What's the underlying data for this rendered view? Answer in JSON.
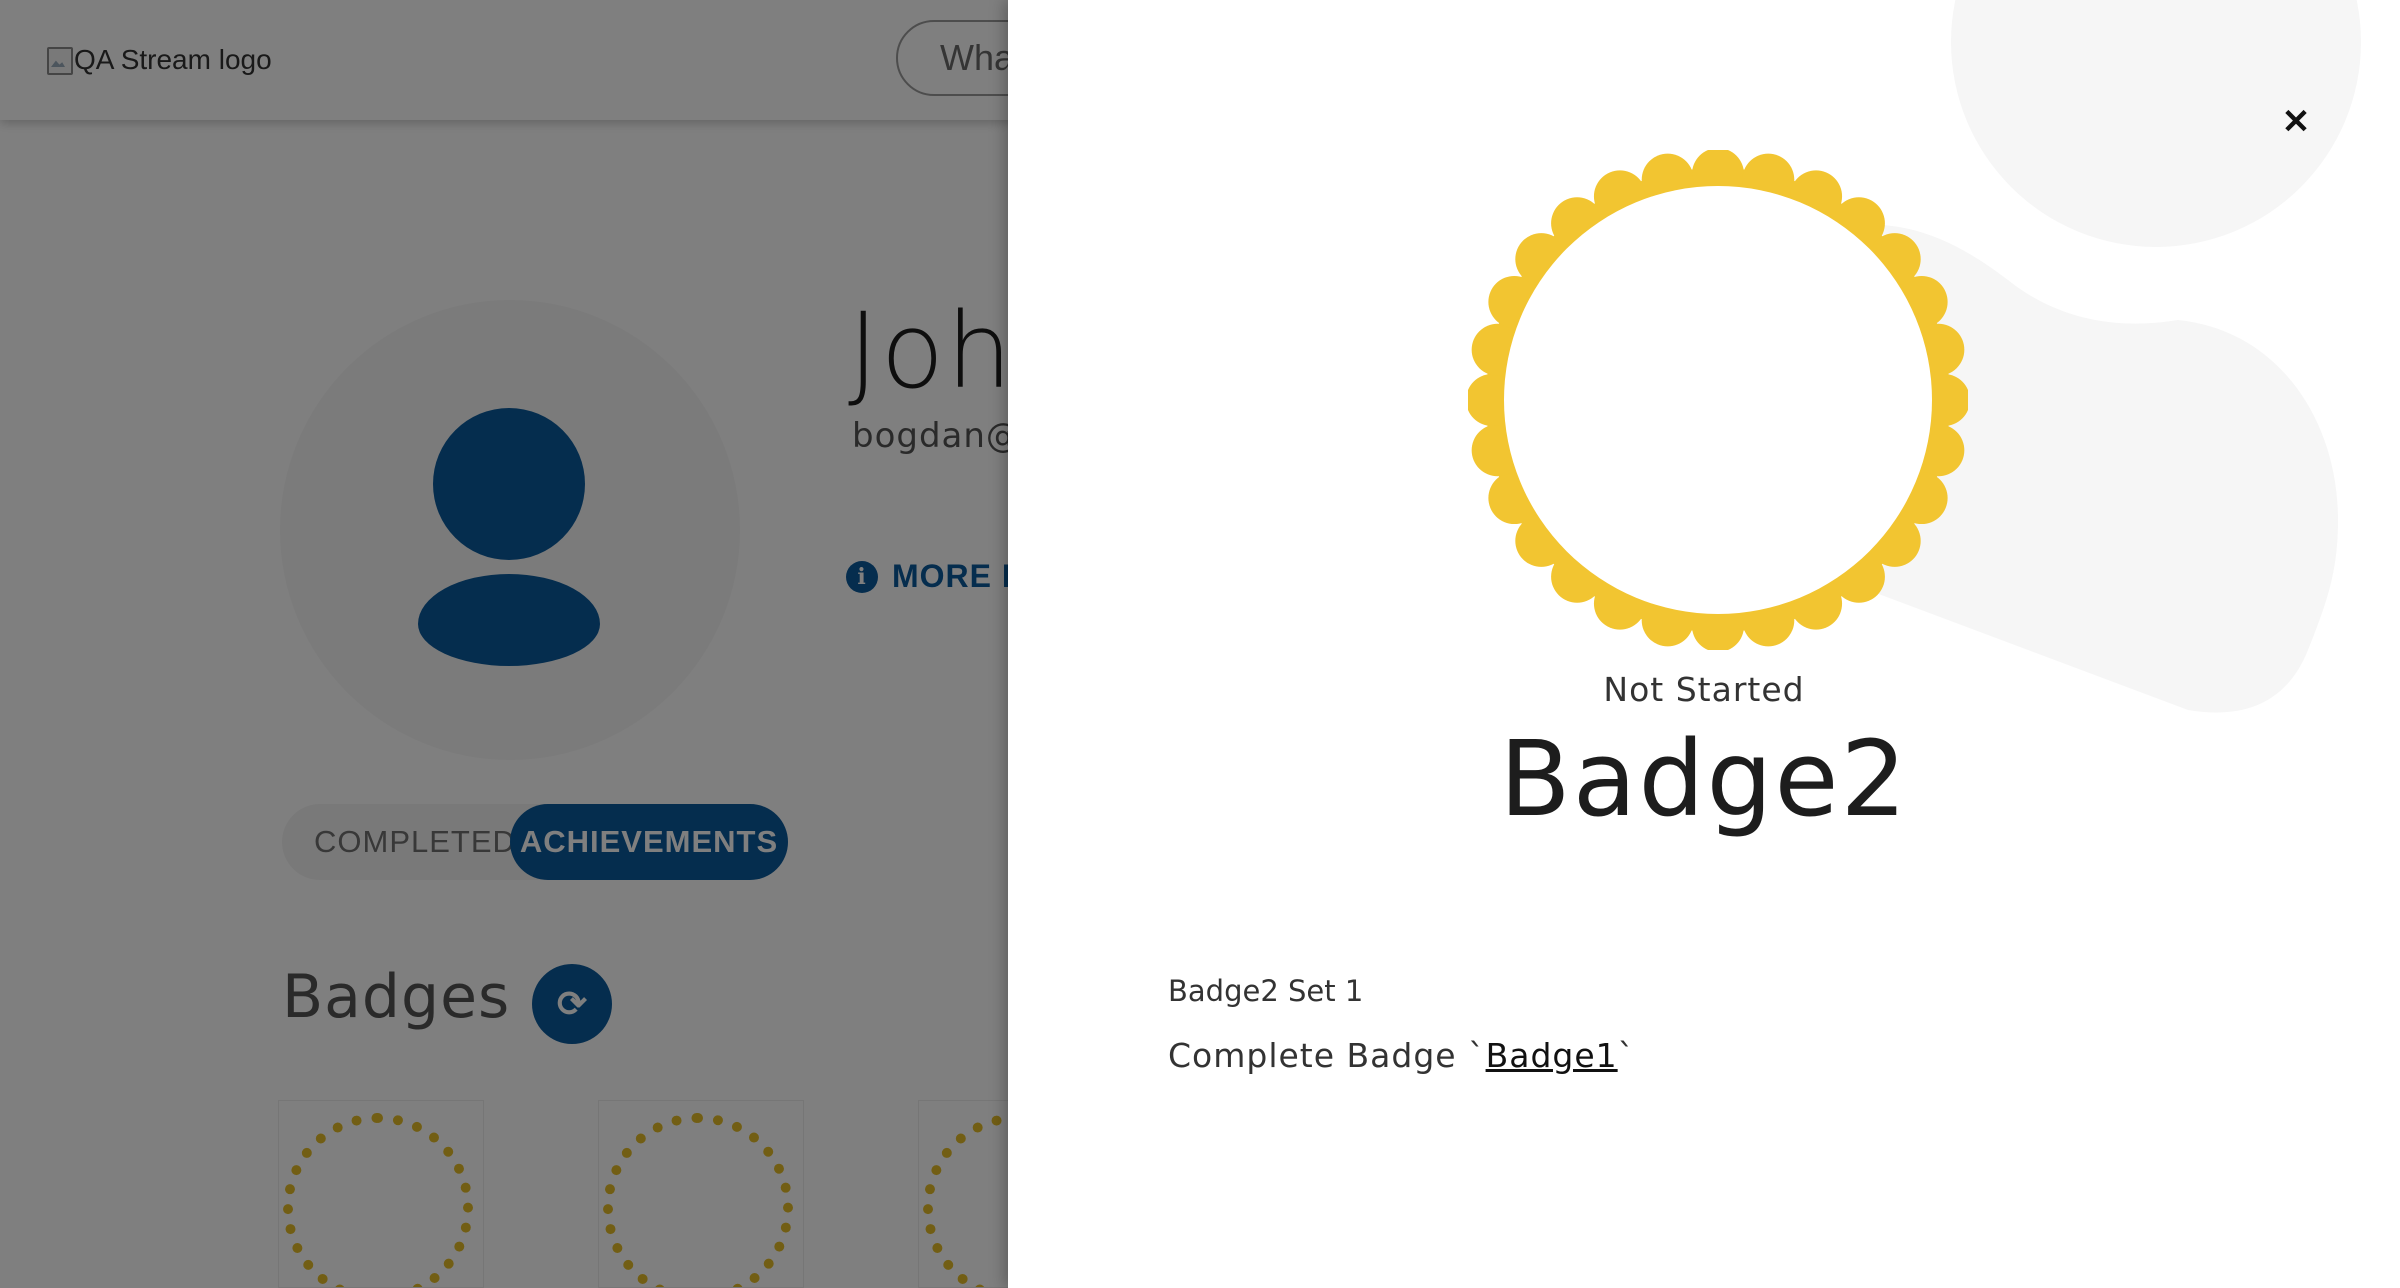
{
  "header": {
    "logo_alt": "QA Stream logo",
    "search_placeholder": "What"
  },
  "profile": {
    "name": "Joh",
    "email": "bogdan@",
    "more_info_label": "MORE IN"
  },
  "tabs": [
    {
      "label": "COMPLETED",
      "active": false
    },
    {
      "label": "ACHIEVEMENTS",
      "active": true
    }
  ],
  "badges_section": {
    "title": "Badges",
    "refresh_icon": "refresh-icon"
  },
  "drawer": {
    "close_icon": "close-icon",
    "badge_status": "Not Started",
    "badge_name": "Badge2",
    "set_name": "Badge2 Set 1",
    "requirement_prefix": "Complete Badge `",
    "requirement_link": "Badge1",
    "requirement_suffix": "`"
  },
  "colors": {
    "brand_blue": "#0b5a9c",
    "badge_gold": "#f2c531",
    "overlay": "rgba(0,0,0,0.5)"
  }
}
